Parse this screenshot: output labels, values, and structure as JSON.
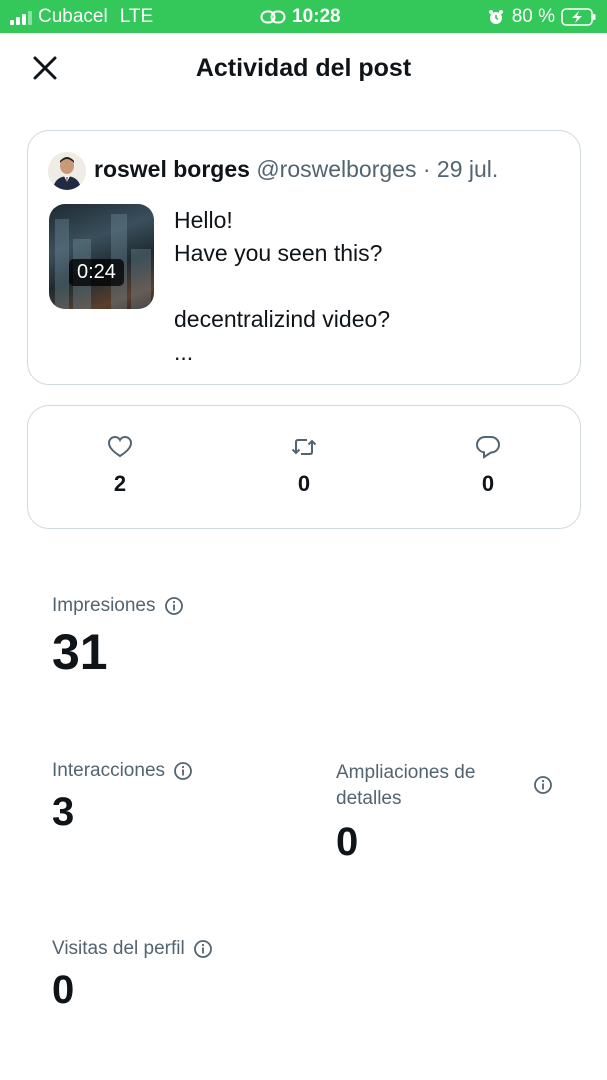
{
  "status_bar": {
    "carrier": "Cubacel",
    "network": "LTE",
    "time": "10:28",
    "battery": "80 %",
    "icons": [
      "signal-icon",
      "link-icon",
      "alarm-icon",
      "battery-charging-icon"
    ]
  },
  "header": {
    "title": "Actividad del post",
    "close_icon": "close-icon"
  },
  "post": {
    "author_name": "roswel borges",
    "handle": "@roswelborges",
    "separator": "·",
    "date": "29 jul.",
    "video_duration": "0:24",
    "text_lines": [
      "Hello!",
      "Have you seen this?",
      "",
      "decentralizind video?",
      "..."
    ]
  },
  "engagement": {
    "likes": "2",
    "reposts": "0",
    "replies": "0"
  },
  "metrics": {
    "impressions": {
      "label": "Impresiones",
      "value": "31"
    },
    "interactions": {
      "label": "Interacciones",
      "value": "3"
    },
    "detail_expands": {
      "label": "Ampliaciones de detalles",
      "value": "0"
    },
    "profile_visits": {
      "label": "Visitas del perfil",
      "value": "0"
    }
  },
  "colors": {
    "status_bar": "#34c759",
    "text_primary": "#0f1419",
    "text_secondary": "#536471",
    "border": "#cfd9de"
  }
}
